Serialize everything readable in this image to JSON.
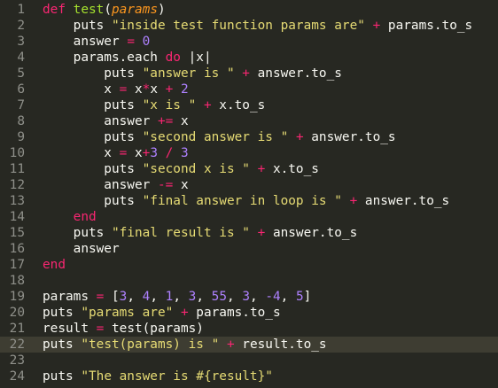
{
  "editor": {
    "current_line": 22,
    "lines": [
      {
        "no": "1",
        "tokens": [
          [
            "kw",
            "def"
          ],
          [
            "plain",
            " "
          ],
          [
            "fn",
            "test"
          ],
          [
            "plain",
            "("
          ],
          [
            "param",
            "params"
          ],
          [
            "plain",
            ")"
          ]
        ]
      },
      {
        "no": "2",
        "tokens": [
          [
            "plain",
            "    puts "
          ],
          [
            "str",
            "\"inside test function params are\""
          ],
          [
            "plain",
            " "
          ],
          [
            "op",
            "+"
          ],
          [
            "plain",
            " params.to_s"
          ]
        ]
      },
      {
        "no": "3",
        "tokens": [
          [
            "plain",
            "    answer "
          ],
          [
            "op",
            "="
          ],
          [
            "plain",
            " "
          ],
          [
            "num",
            "0"
          ]
        ]
      },
      {
        "no": "4",
        "tokens": [
          [
            "plain",
            "    params.each "
          ],
          [
            "kw",
            "do"
          ],
          [
            "plain",
            " |x|"
          ]
        ]
      },
      {
        "no": "5",
        "tokens": [
          [
            "plain",
            "        puts "
          ],
          [
            "str",
            "\"answer is \""
          ],
          [
            "plain",
            " "
          ],
          [
            "op",
            "+"
          ],
          [
            "plain",
            " answer.to_s"
          ]
        ]
      },
      {
        "no": "6",
        "tokens": [
          [
            "plain",
            "        x "
          ],
          [
            "op",
            "="
          ],
          [
            "plain",
            " x"
          ],
          [
            "op",
            "*"
          ],
          [
            "plain",
            "x "
          ],
          [
            "op",
            "+"
          ],
          [
            "plain",
            " "
          ],
          [
            "num",
            "2"
          ]
        ]
      },
      {
        "no": "7",
        "tokens": [
          [
            "plain",
            "        puts "
          ],
          [
            "str",
            "\"x is \""
          ],
          [
            "plain",
            " "
          ],
          [
            "op",
            "+"
          ],
          [
            "plain",
            " x.to_s"
          ]
        ]
      },
      {
        "no": "8",
        "tokens": [
          [
            "plain",
            "        answer "
          ],
          [
            "op",
            "+="
          ],
          [
            "plain",
            " x"
          ]
        ]
      },
      {
        "no": "9",
        "tokens": [
          [
            "plain",
            "        puts "
          ],
          [
            "str",
            "\"second answer is \""
          ],
          [
            "plain",
            " "
          ],
          [
            "op",
            "+"
          ],
          [
            "plain",
            " answer.to_s"
          ]
        ]
      },
      {
        "no": "10",
        "tokens": [
          [
            "plain",
            "        x "
          ],
          [
            "op",
            "="
          ],
          [
            "plain",
            " x"
          ],
          [
            "op",
            "+"
          ],
          [
            "num",
            "3"
          ],
          [
            "plain",
            " "
          ],
          [
            "op",
            "/"
          ],
          [
            "plain",
            " "
          ],
          [
            "num",
            "3"
          ]
        ]
      },
      {
        "no": "11",
        "tokens": [
          [
            "plain",
            "        puts "
          ],
          [
            "str",
            "\"second x is \""
          ],
          [
            "plain",
            " "
          ],
          [
            "op",
            "+"
          ],
          [
            "plain",
            " x.to_s"
          ]
        ]
      },
      {
        "no": "12",
        "tokens": [
          [
            "plain",
            "        answer "
          ],
          [
            "op",
            "-="
          ],
          [
            "plain",
            " x"
          ]
        ]
      },
      {
        "no": "13",
        "tokens": [
          [
            "plain",
            "        puts "
          ],
          [
            "str",
            "\"final answer in loop is \""
          ],
          [
            "plain",
            " "
          ],
          [
            "op",
            "+"
          ],
          [
            "plain",
            " answer.to_s"
          ]
        ]
      },
      {
        "no": "14",
        "tokens": [
          [
            "plain",
            "    "
          ],
          [
            "kw",
            "end"
          ]
        ]
      },
      {
        "no": "15",
        "tokens": [
          [
            "plain",
            "    puts "
          ],
          [
            "str",
            "\"final result is \""
          ],
          [
            "plain",
            " "
          ],
          [
            "op",
            "+"
          ],
          [
            "plain",
            " answer.to_s"
          ]
        ]
      },
      {
        "no": "16",
        "tokens": [
          [
            "plain",
            "    answer"
          ]
        ]
      },
      {
        "no": "17",
        "tokens": [
          [
            "kw",
            "end"
          ]
        ]
      },
      {
        "no": "18",
        "tokens": []
      },
      {
        "no": "19",
        "tokens": [
          [
            "plain",
            "params "
          ],
          [
            "op",
            "="
          ],
          [
            "plain",
            " ["
          ],
          [
            "num",
            "3"
          ],
          [
            "plain",
            ", "
          ],
          [
            "num",
            "4"
          ],
          [
            "plain",
            ", "
          ],
          [
            "num",
            "1"
          ],
          [
            "plain",
            ", "
          ],
          [
            "num",
            "3"
          ],
          [
            "plain",
            ", "
          ],
          [
            "num",
            "55"
          ],
          [
            "plain",
            ", "
          ],
          [
            "num",
            "3"
          ],
          [
            "plain",
            ", "
          ],
          [
            "num",
            "-4"
          ],
          [
            "plain",
            ", "
          ],
          [
            "num",
            "5"
          ],
          [
            "plain",
            "]"
          ]
        ]
      },
      {
        "no": "20",
        "tokens": [
          [
            "plain",
            "puts "
          ],
          [
            "str",
            "\"params are\""
          ],
          [
            "plain",
            " "
          ],
          [
            "op",
            "+"
          ],
          [
            "plain",
            " params.to_s"
          ]
        ]
      },
      {
        "no": "21",
        "tokens": [
          [
            "plain",
            "result "
          ],
          [
            "op",
            "="
          ],
          [
            "plain",
            " test(params)"
          ]
        ]
      },
      {
        "no": "22",
        "tokens": [
          [
            "plain",
            "puts "
          ],
          [
            "str",
            "\"test(params) is \""
          ],
          [
            "plain",
            " "
          ],
          [
            "op",
            "+"
          ],
          [
            "plain",
            " result.to_s"
          ]
        ]
      },
      {
        "no": "23",
        "tokens": []
      },
      {
        "no": "24",
        "tokens": [
          [
            "plain",
            "puts "
          ],
          [
            "str",
            "\"The answer is #{result}\""
          ]
        ]
      }
    ]
  },
  "colors": {
    "background": "#272822",
    "current_line": "#3e3d32",
    "keyword": "#f92672",
    "function": "#a6e22e",
    "parameter": "#fd971f",
    "string": "#e6db74",
    "number": "#ae81ff",
    "text": "#f8f8f2",
    "line_number": "#8f908a"
  }
}
